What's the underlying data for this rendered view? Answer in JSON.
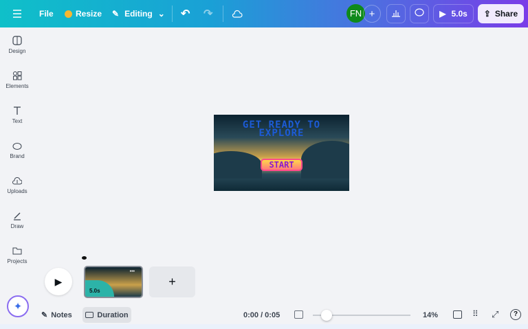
{
  "topbar": {
    "file": "File",
    "resize": "Resize",
    "editing": "Editing",
    "avatar_initials": "FN",
    "play_duration": "5.0s",
    "share": "Share"
  },
  "sidebar": {
    "items": [
      {
        "label": "Design"
      },
      {
        "label": "Elements"
      },
      {
        "label": "Text"
      },
      {
        "label": "Brand"
      },
      {
        "label": "Uploads"
      },
      {
        "label": "Draw"
      },
      {
        "label": "Projects"
      }
    ]
  },
  "design": {
    "title_line1": "GET READY TO",
    "title_line2": "EXPLORE",
    "button": "START"
  },
  "timeline": {
    "page_duration": "5.0s",
    "more": "•••",
    "add": "+"
  },
  "bottombar": {
    "notes": "Notes",
    "duration": "Duration",
    "time": "0:00 / 0:05",
    "zoom": "14%",
    "zoom_percent": 14
  },
  "colors": {
    "accent": "#7a3ce8",
    "avatar": "#0f8a1a"
  }
}
